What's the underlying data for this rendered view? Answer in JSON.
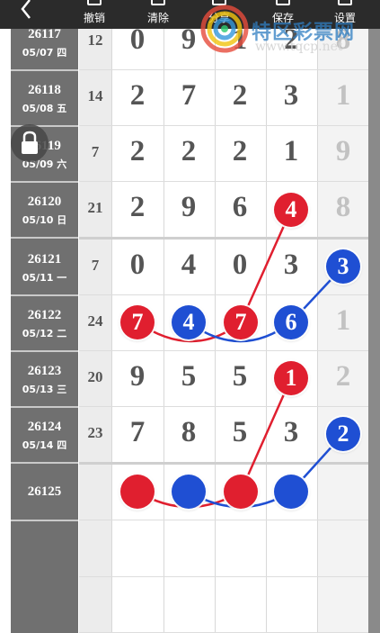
{
  "toolbar": {
    "buttons": [
      {
        "label": "撤销",
        "icon": "undo-icon"
      },
      {
        "label": "清除",
        "icon": "trash-icon"
      },
      {
        "label": "分享",
        "icon": "share-icon"
      },
      {
        "label": "保存",
        "icon": "save-icon"
      },
      {
        "label": "设置",
        "icon": "settings-icon"
      }
    ]
  },
  "watermark": {
    "text": "特区彩票网",
    "url": "www.tqcp.net"
  },
  "colors": {
    "red_ball": "#e01f2f",
    "blue_ball": "#1f4fd3",
    "left_col": "#707070"
  },
  "rows": [
    {
      "period": "26117",
      "date": "05/07 四",
      "sum": "12",
      "digits": [
        "0",
        "9",
        "1",
        "2"
      ],
      "side": "8"
    },
    {
      "period": "26118",
      "date": "05/08 五",
      "sum": "14",
      "digits": [
        "2",
        "7",
        "2",
        "3"
      ],
      "side": "1"
    },
    {
      "period": "26119",
      "date": "05/09 六",
      "sum": "7",
      "digits": [
        "2",
        "2",
        "2",
        "1"
      ],
      "side": "9"
    },
    {
      "period": "26120",
      "date": "05/10 日",
      "sum": "21",
      "digits": [
        "2",
        "9",
        "6",
        "4"
      ],
      "side": "8"
    },
    {
      "period": "26121",
      "date": "05/11 一",
      "sum": "7",
      "digits": [
        "0",
        "4",
        "0",
        "3"
      ],
      "side": "3"
    },
    {
      "period": "26122",
      "date": "05/12 二",
      "sum": "24",
      "digits": [
        "7",
        "4",
        "7",
        "6"
      ],
      "side": "1"
    },
    {
      "period": "26123",
      "date": "05/13 三",
      "sum": "20",
      "digits": [
        "9",
        "5",
        "5",
        "1"
      ],
      "side": "2"
    },
    {
      "period": "26124",
      "date": "05/14 四",
      "sum": "23",
      "digits": [
        "7",
        "8",
        "5",
        "3"
      ],
      "side": "2"
    },
    {
      "period": "26125",
      "date": "",
      "sum": "",
      "digits": [
        "",
        "",
        "",
        ""
      ],
      "side": ""
    }
  ]
}
